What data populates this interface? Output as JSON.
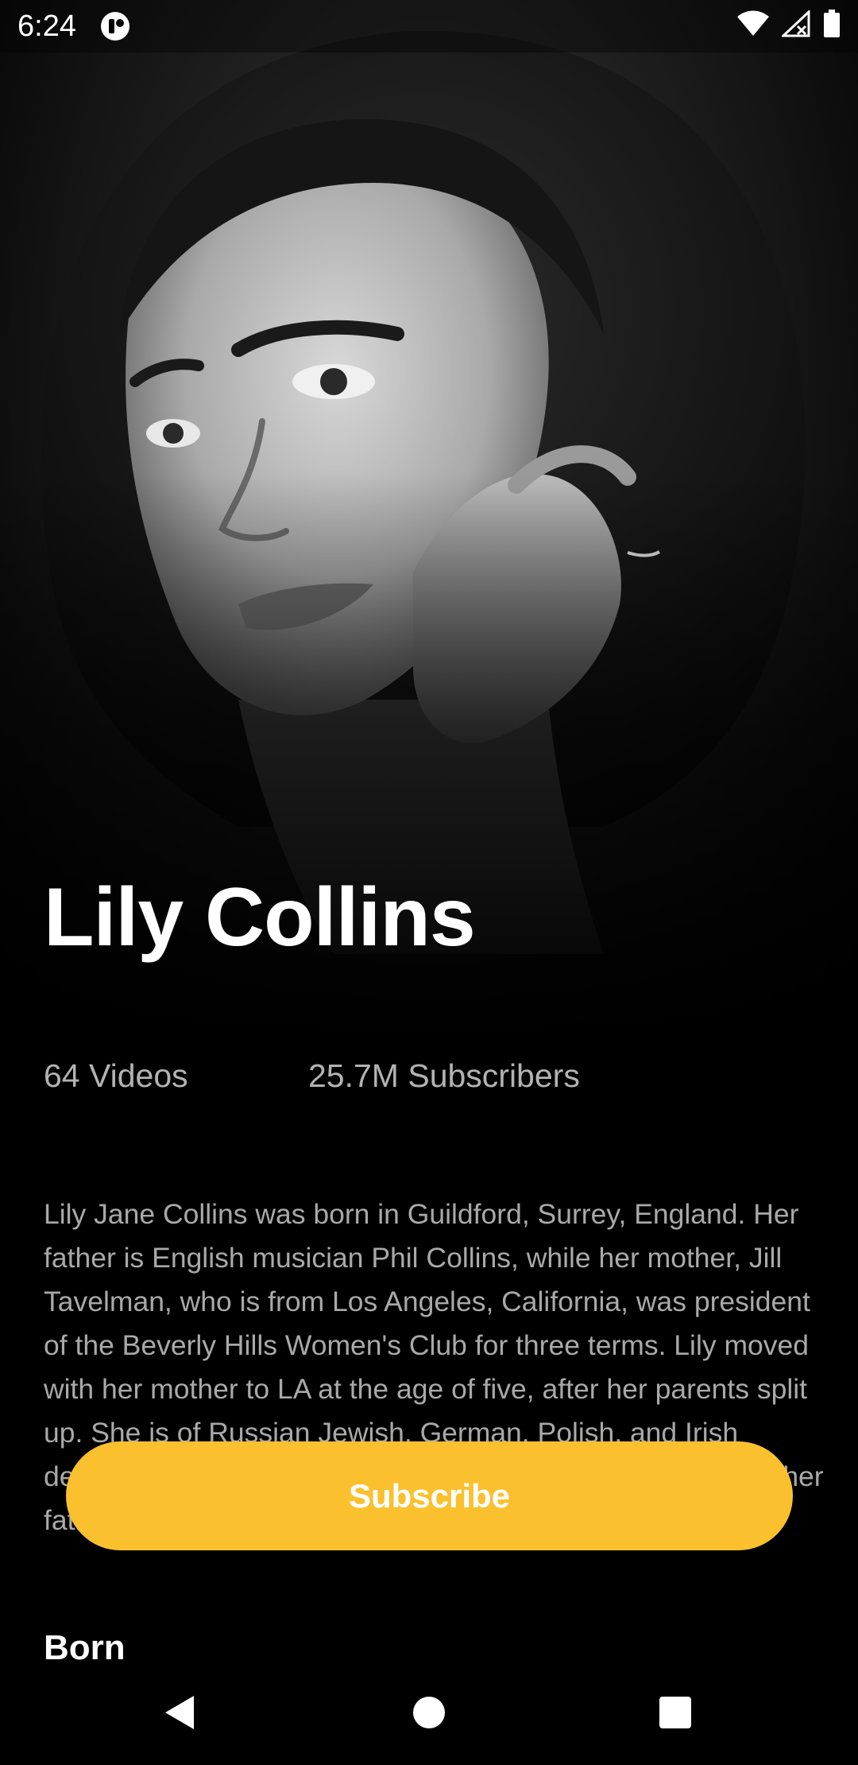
{
  "status_bar": {
    "time": "6:24",
    "icons": [
      "app-notification-icon",
      "wifi-icon",
      "cellular-signal-icon",
      "battery-icon"
    ]
  },
  "profile": {
    "name": "Lily Collins",
    "videos": "64 Videos",
    "subscribers": "25.7M Subscribers",
    "bio": "Lily Jane Collins was born in Guildford, Surrey, England. Her father is English musician Phil Collins, while her mother, Jill Tavelman, who is from Los Angeles, California, was president of the Beverly Hills Women's Club for three terms. Lily moved with her mother to LA at the age of five, after her parents split up. She is of Russian Jewish, German, Polish, and Irish descent on her mother's side, and has English ancestry on her father's side.",
    "born_label": "Born"
  },
  "actions": {
    "subscribe_label": "Subscribe"
  },
  "nav": {
    "icons": [
      "back-icon",
      "home-icon",
      "recents-icon"
    ]
  },
  "colors": {
    "accent": "#FBC02D",
    "background": "#000000",
    "secondary_text": "#B3B3B3"
  }
}
